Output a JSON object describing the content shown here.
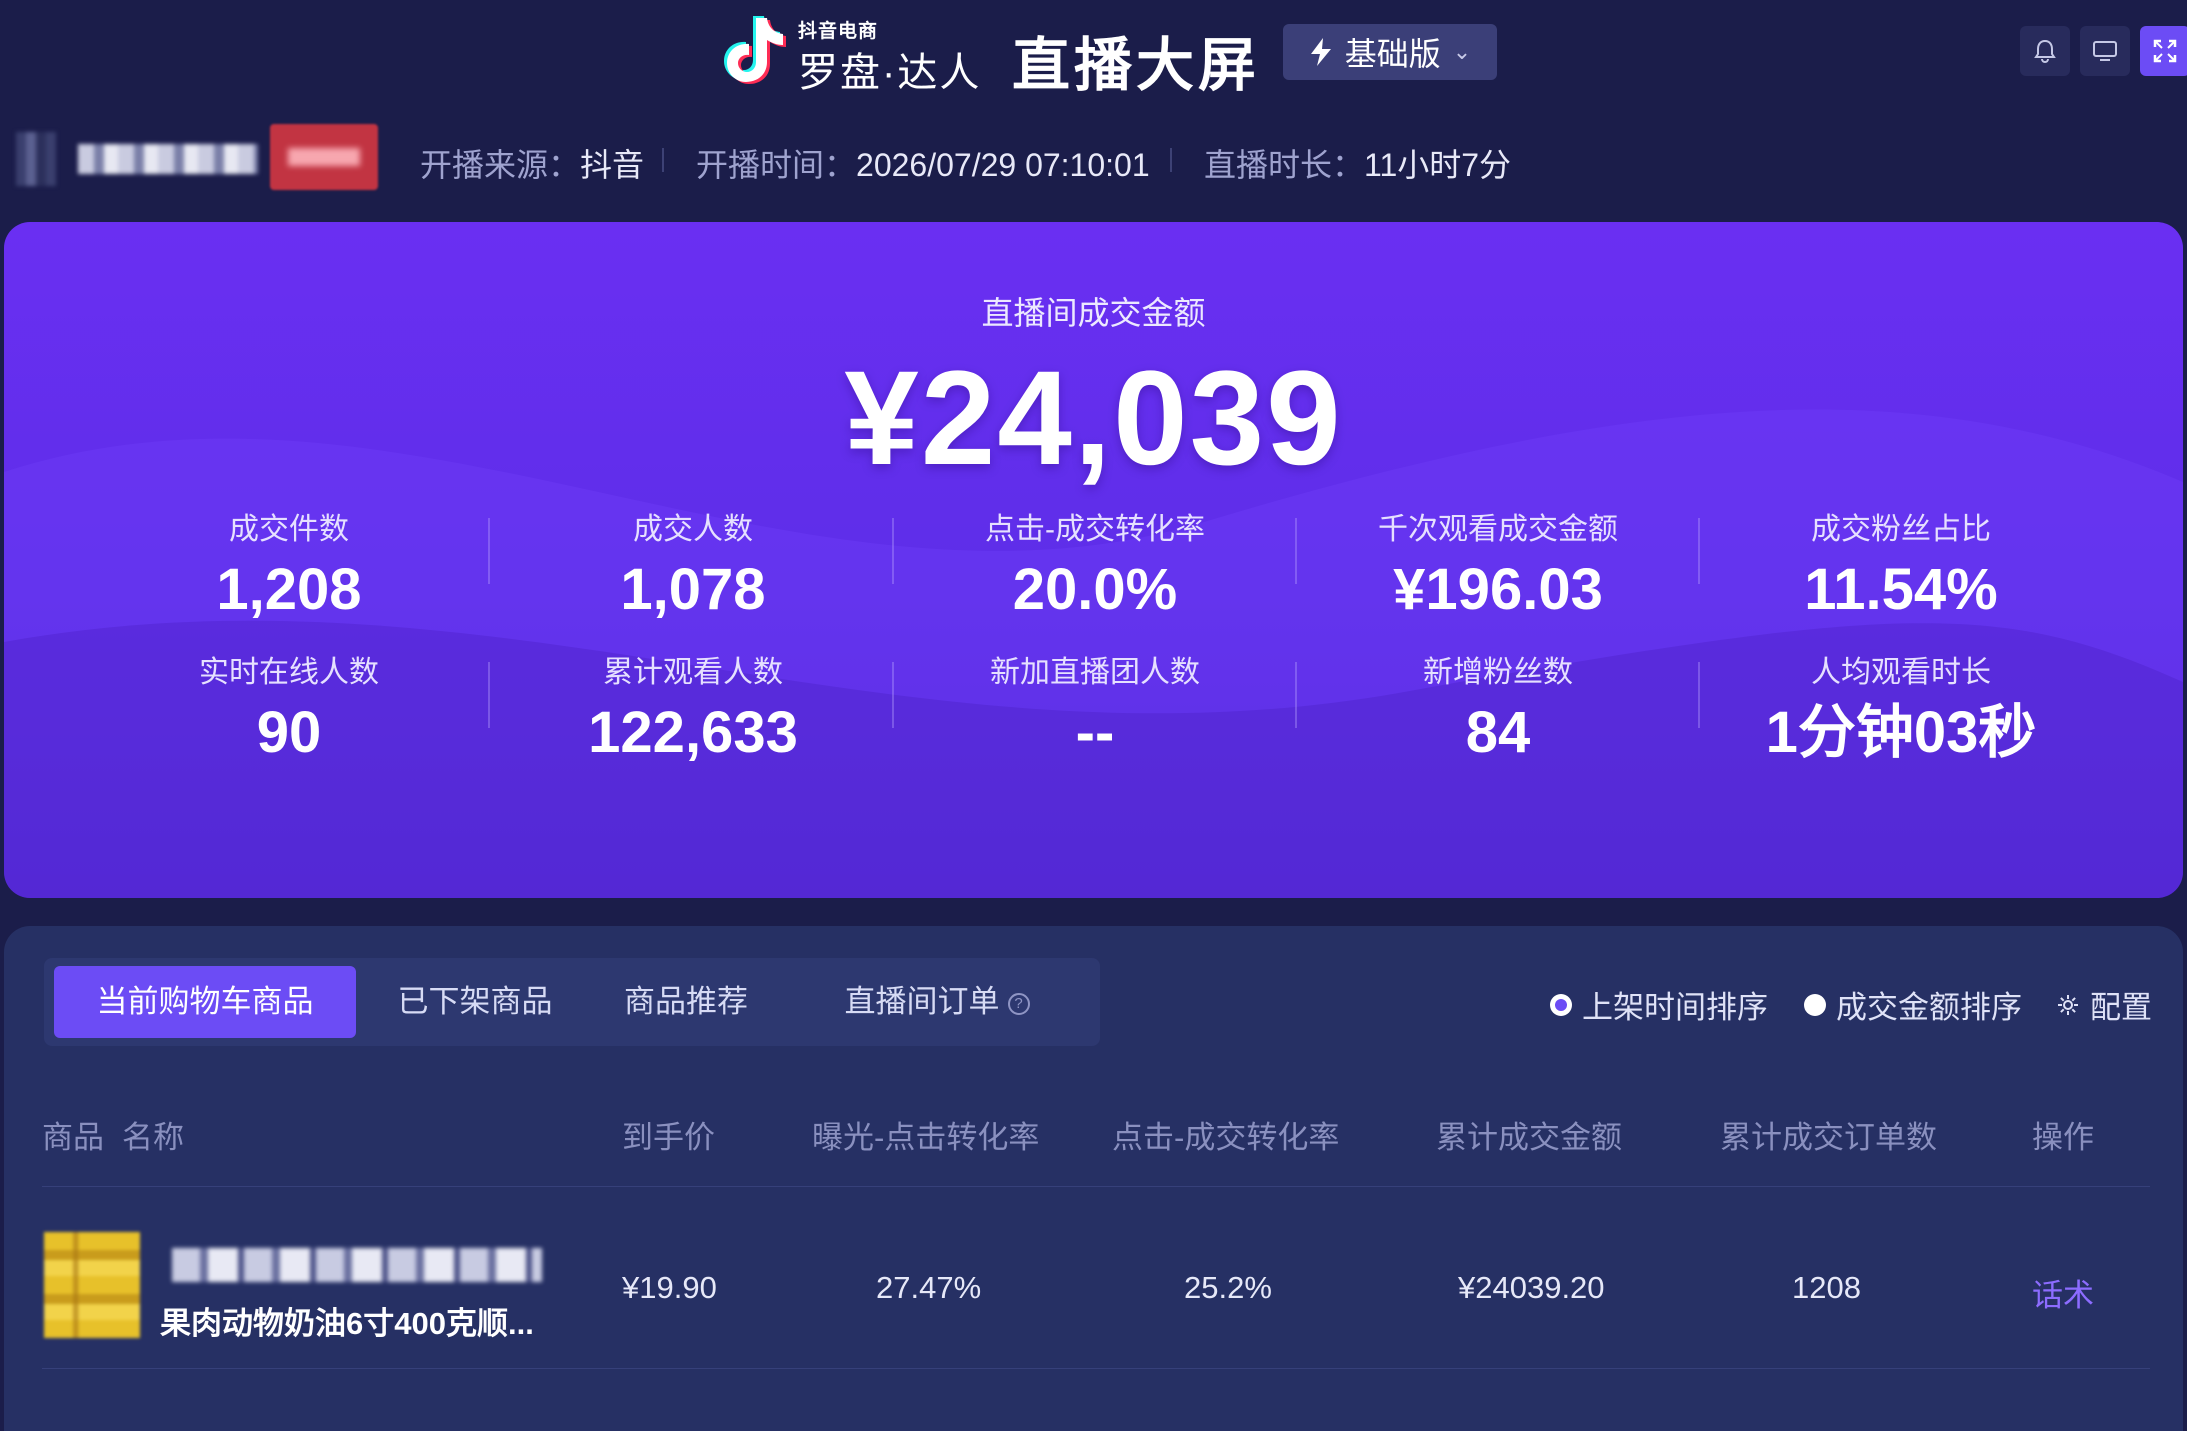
{
  "header": {
    "logo_sub": "抖音电商",
    "logo_main": "罗盘·达人",
    "title": "直播大屏",
    "version_label": "基础版"
  },
  "live_info": {
    "source_key": "开播来源：",
    "source_value": "抖音",
    "start_key": "开播时间：",
    "start_value": "2026/07/29 07:10:01",
    "duration_key": "直播时长：",
    "duration_value": "11小时7分"
  },
  "hero": {
    "label": "直播间成交金额",
    "amount": "¥24,039",
    "metrics_row1": [
      {
        "label": "成交件数",
        "value": "1,208"
      },
      {
        "label": "成交人数",
        "value": "1,078"
      },
      {
        "label": "点击-成交转化率",
        "value": "20.0%"
      },
      {
        "label": "千次观看成交金额",
        "value": "¥196.03"
      },
      {
        "label": "成交粉丝占比",
        "value": "11.54%"
      }
    ],
    "metrics_row2": [
      {
        "label": "实时在线人数",
        "value": "90"
      },
      {
        "label": "累计观看人数",
        "value": "122,633"
      },
      {
        "label": "新加直播团人数",
        "value": "--"
      },
      {
        "label": "新增粉丝数",
        "value": "84"
      },
      {
        "label": "人均观看时长",
        "value": "1分钟03秒"
      }
    ]
  },
  "products": {
    "tabs": [
      {
        "label": "当前购物车商品",
        "active": true
      },
      {
        "label": "已下架商品",
        "active": false
      },
      {
        "label": "商品推荐",
        "active": false
      },
      {
        "label": "直播间订单",
        "active": false
      }
    ],
    "sort_options": [
      {
        "label": "上架时间排序",
        "selected": true
      },
      {
        "label": "成交金额排序",
        "selected": false
      }
    ],
    "config_label": "配置",
    "columns": [
      "商品",
      "名称",
      "到手价",
      "曝光-点击转化率",
      "点击-成交转化率",
      "累计成交金额",
      "累计成交订单数",
      "操作"
    ],
    "rows": [
      {
        "name": "果肉动物奶油6寸400克顺...",
        "price": "¥19.90",
        "exposure_click_rate": "27.47%",
        "click_deal_rate": "25.2%",
        "total_amount": "¥24039.20",
        "total_orders": "1208",
        "action": "话术"
      }
    ]
  },
  "colors": {
    "background": "#1b1d4a",
    "accent": "#6c4cf5",
    "hero_gradient_top": "#6a2ff2",
    "panel": "#263064",
    "link": "#8c6cff"
  },
  "icons": [
    "tiktok-logo-icon",
    "lightning-icon",
    "chevron-down-icon",
    "bell-icon",
    "monitor-icon",
    "fullscreen-icon",
    "help-circle-icon",
    "gear-icon"
  ]
}
